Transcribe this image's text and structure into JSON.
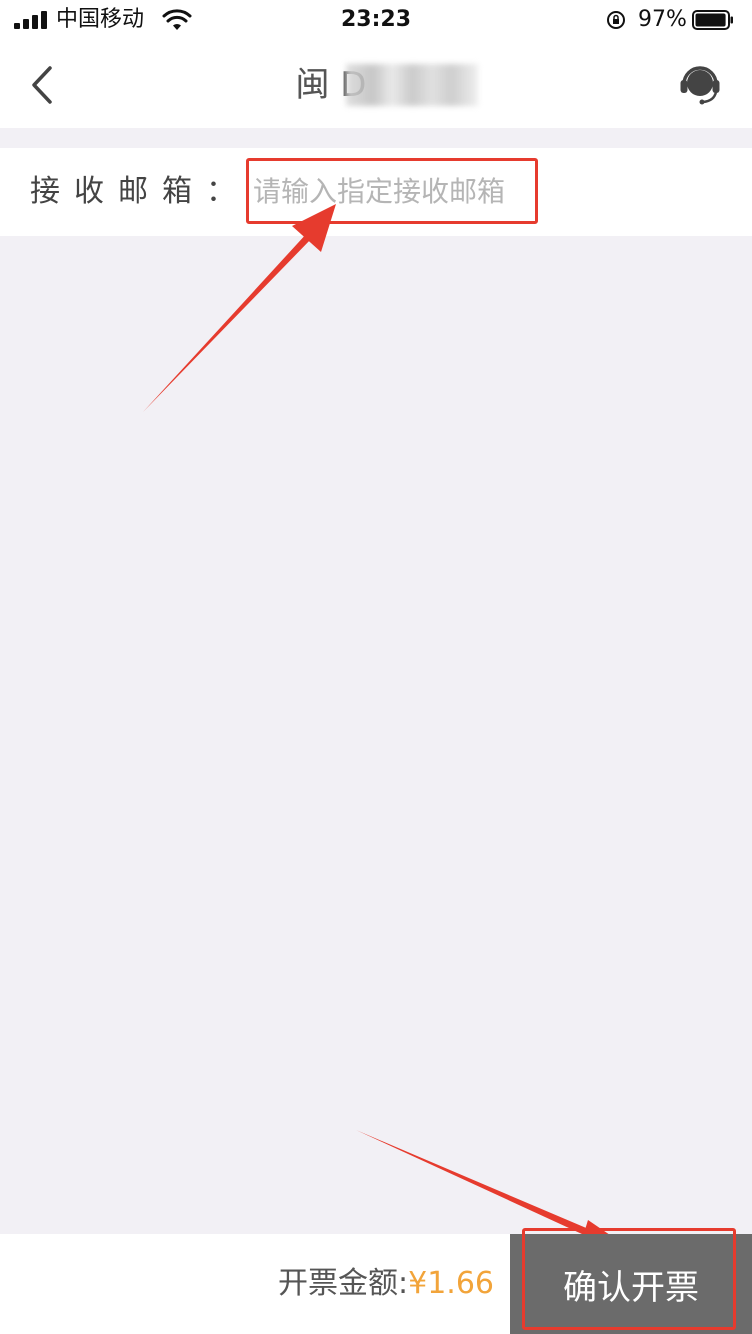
{
  "status_bar": {
    "carrier": "中国移动",
    "time": "23:23",
    "battery_percent": "97%",
    "icons": [
      "signal-icon",
      "wifi-icon",
      "rotation-lock-icon",
      "battery-icon"
    ],
    "battery_level": 0.97
  },
  "nav": {
    "title": "闽 D",
    "back_icon": "chevron-left-icon",
    "service_icon": "customer-service-headset-icon"
  },
  "email": {
    "label": "接收邮箱：",
    "placeholder": "请输入指定接收邮箱",
    "value": ""
  },
  "footer": {
    "amount_label": "开票金额:",
    "amount_value": "¥1.66",
    "confirm_label": "确认开票"
  },
  "colors": {
    "accent_amount": "#f2a43a",
    "annotation_red": "#e63b2e",
    "confirm_bg": "#6b6b6b",
    "page_bg": "#f2f0f5"
  }
}
